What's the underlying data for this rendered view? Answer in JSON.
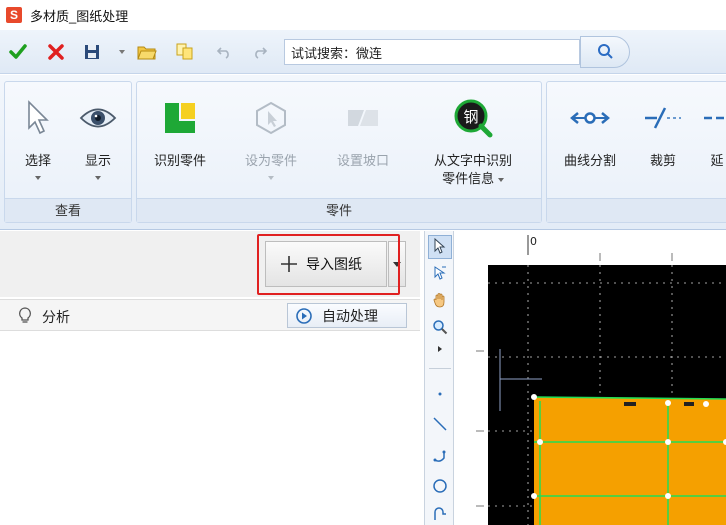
{
  "window": {
    "title": "多材质_图纸处理",
    "logo_glyph": "S"
  },
  "quick_access": {
    "search_value": "试试搜索：微连",
    "items": [
      "confirm-icon",
      "cancel-icon",
      "save-icon",
      "open-folder-icon",
      "copy-icon",
      "undo-icon",
      "redo-icon"
    ]
  },
  "ribbon": {
    "groups": [
      {
        "label": "查看",
        "buttons": [
          {
            "label": "选择",
            "icon": "cursor-icon"
          },
          {
            "label": "显示",
            "icon": "eye-icon"
          }
        ]
      },
      {
        "label": "零件",
        "buttons": [
          {
            "label": "识别零件",
            "icon": "identify-part-icon"
          },
          {
            "label": "设为零件",
            "icon": "set-part-icon",
            "disabled": true
          },
          {
            "label": "设置坡口",
            "icon": "bevel-icon",
            "disabled": true
          },
          {
            "label": "从文字中识别",
            "label2": "零件信息",
            "icon": "steel-search-icon"
          }
        ]
      },
      {
        "label": "",
        "buttons": [
          {
            "label": "曲线分割",
            "icon": "curve-split-icon"
          },
          {
            "label": "裁剪",
            "icon": "trim-icon"
          },
          {
            "label": "延",
            "icon": "extend-icon"
          }
        ]
      }
    ]
  },
  "left_panel": {
    "import_button": "导入图纸",
    "analysis_label": "分析",
    "auto_process_button": "自动处理"
  },
  "canvas": {
    "ruler_zero": "0",
    "colors": {
      "background": "#000000",
      "part_fill": "#f5a000",
      "part_edge": "#22dd55",
      "accent": "#e02020"
    }
  }
}
